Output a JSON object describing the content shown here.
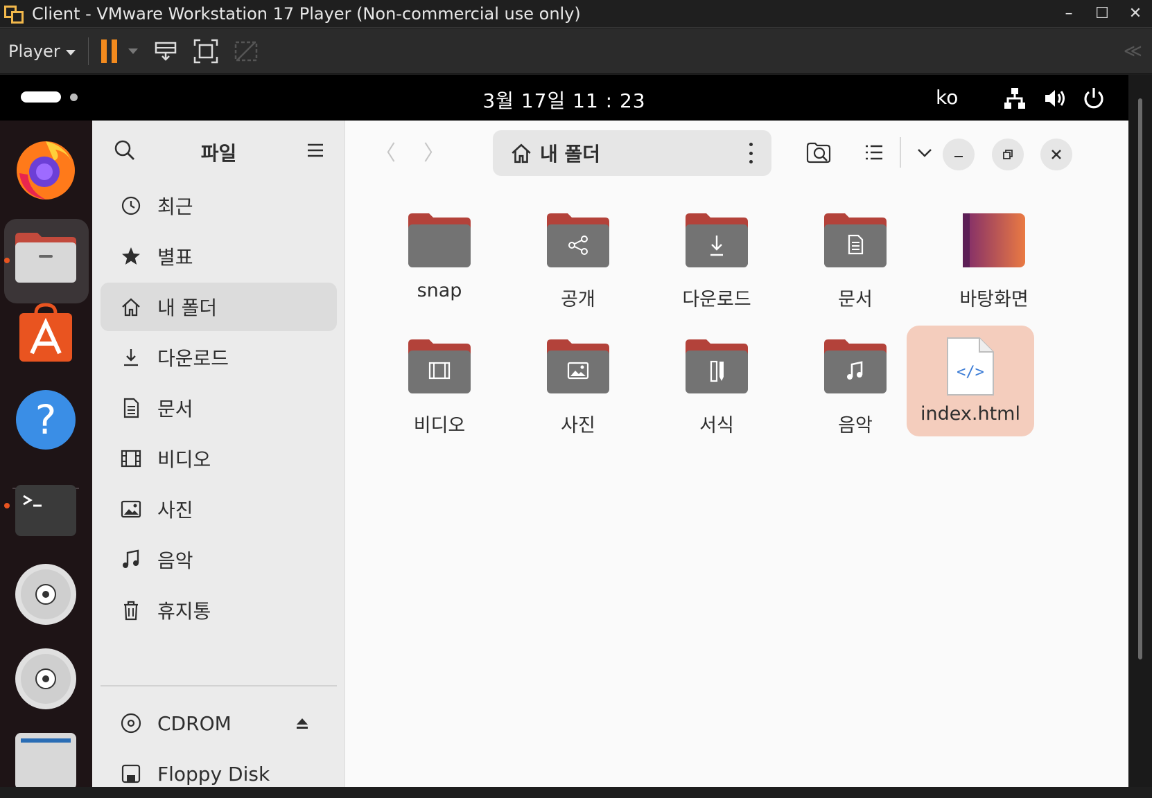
{
  "window": {
    "title": "Client - VMware Workstation 17 Player (Non-commercial use only)",
    "controls": [
      "minimize",
      "maximize",
      "close"
    ]
  },
  "vm_toolbar": {
    "player_label": "Player",
    "icons": [
      "pause-icon",
      "send-ctrl-alt-del-icon",
      "full-screen-icon",
      "unity-icon"
    ],
    "collapse_glyph": "≪"
  },
  "ubuntu_topbar": {
    "clock": "3월 17일  11 : 23",
    "input_lang": "ko",
    "indicators": [
      "network-icon",
      "volume-icon",
      "power-icon"
    ]
  },
  "dock": {
    "apps": [
      "firefox",
      "files",
      "app-center",
      "help",
      "terminal",
      "cdrom",
      "cdrom",
      "show-apps"
    ]
  },
  "files": {
    "sidebar_title": "파일",
    "places": [
      {
        "label": "최근",
        "icon": "recent-icon"
      },
      {
        "label": "별표",
        "icon": "star-icon"
      },
      {
        "label": "내 폴더",
        "icon": "home-icon",
        "active": true
      },
      {
        "label": "다운로드",
        "icon": "download-icon"
      },
      {
        "label": "문서",
        "icon": "document-icon"
      },
      {
        "label": "비디오",
        "icon": "video-icon"
      },
      {
        "label": "사진",
        "icon": "picture-icon"
      },
      {
        "label": "음악",
        "icon": "music-icon"
      },
      {
        "label": "휴지통",
        "icon": "trash-icon"
      }
    ],
    "devices": [
      {
        "label": "CDROM",
        "icon": "disc-icon"
      },
      {
        "label": "Floppy Disk",
        "icon": "floppy-icon"
      }
    ],
    "path_label": "내 폴더",
    "items": [
      {
        "label": "snap",
        "kind": "folder"
      },
      {
        "label": "공개",
        "kind": "share"
      },
      {
        "label": "다운로드",
        "kind": "download"
      },
      {
        "label": "문서",
        "kind": "document"
      },
      {
        "label": "바탕화면",
        "kind": "desktop"
      },
      {
        "label": "비디오",
        "kind": "video"
      },
      {
        "label": "사진",
        "kind": "picture"
      },
      {
        "label": "서식",
        "kind": "template"
      },
      {
        "label": "음악",
        "kind": "music"
      },
      {
        "label": "index.html",
        "kind": "html",
        "selected": true
      }
    ]
  },
  "colors": {
    "accent": "#e95420",
    "folder_tab": "#b3423a",
    "folder_body": "#737373",
    "selection": "#f4cdbd"
  }
}
